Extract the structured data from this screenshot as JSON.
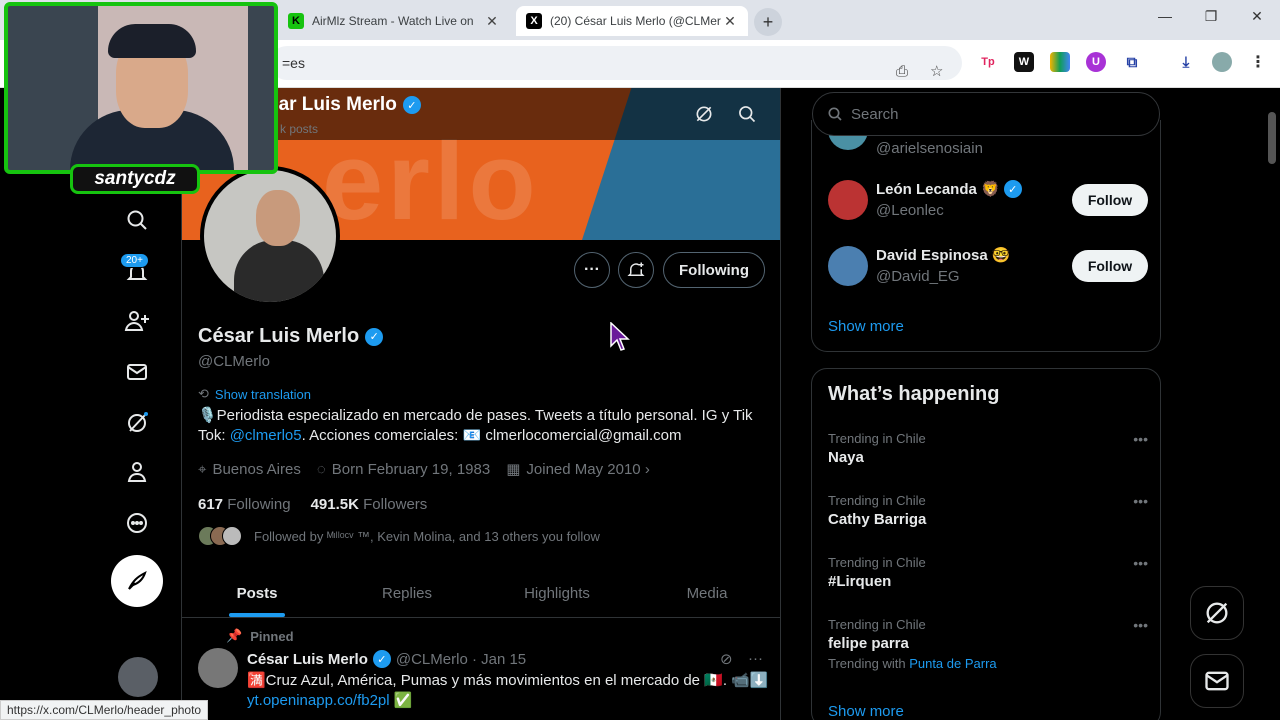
{
  "browser": {
    "tabs": [
      {
        "title": "AirMlz Stream - Watch Live on ",
        "favicon": "K",
        "active": false
      },
      {
        "title": "(20) César Luis Merlo (@CLMer",
        "favicon": "X",
        "active": true
      }
    ],
    "new_tab": "+",
    "window_controls": {
      "minimize": "—",
      "restore": "❐",
      "close": "✕"
    },
    "url_fragment": "=es",
    "status_url": "https://x.com/CLMerlo/header_photo"
  },
  "webcam": {
    "streamer_name": "santycdz"
  },
  "nav": {
    "notifications_badge": "20+"
  },
  "header": {
    "name": "sar Luis Merlo",
    "posts_count": "k posts"
  },
  "profile": {
    "name": "César Luis Merlo",
    "handle": "@CLMerlo",
    "show_translation": "Show translation",
    "bio_part1": "🎙️Periodista especializado en mercado de pases. Tweets a título personal. IG y Tik Tok: ",
    "bio_link": "@clmerlo5",
    "bio_part2": ". Acciones comerciales: 📧 clmerlocomercial@gmail.com",
    "location": "Buenos Aires",
    "born": "Born February 19, 1983",
    "joined": "Joined May 2010",
    "following_count": "617",
    "following_label": "Following",
    "followers_count": "491.5K",
    "followers_label": "Followers",
    "followed_by": "Followed by ᴹᶦˡˡᵒᶜᵛ ™, Kevin Molina, and 13 others you follow",
    "following_button": "Following"
  },
  "profile_tabs": [
    "Posts",
    "Replies",
    "Highlights",
    "Media"
  ],
  "pinned_tweet": {
    "pinned_label": "Pinned",
    "author": "César Luis Merlo",
    "handle_date": "@CLMerlo · Jan 15",
    "text": "🈵Cruz Azul, América, Pumas y más movimientos en el mercado de 🇲🇽. 📹⬇️",
    "link": "yt.openinapp.co/fb2pl ✅"
  },
  "sidebar": {
    "search_placeholder": "Search",
    "who_to_follow": [
      {
        "name": "",
        "handle": "@arielsenosiain"
      },
      {
        "name": "León Lecanda 🦁",
        "handle": "@Leonlec",
        "button": "Follow"
      },
      {
        "name": "David Espinosa 🤓",
        "handle": "@David_EG",
        "button": "Follow"
      }
    ],
    "show_more": "Show more",
    "trends_title": "What’s happening",
    "trends": [
      {
        "category": "Trending in Chile",
        "name": "Naya"
      },
      {
        "category": "Trending in Chile",
        "name": "Cathy Barriga"
      },
      {
        "category": "Trending in Chile",
        "name": "#Lirquen"
      },
      {
        "category": "Trending in Chile",
        "name": "felipe parra",
        "with_label": "Trending with",
        "with_value": "Punta de Parra"
      }
    ],
    "trends_show_more": "Show more"
  },
  "colors": {
    "accent": "#1d9bf0",
    "stream_green": "#16c30f",
    "banner_orange": "#e8621e"
  }
}
